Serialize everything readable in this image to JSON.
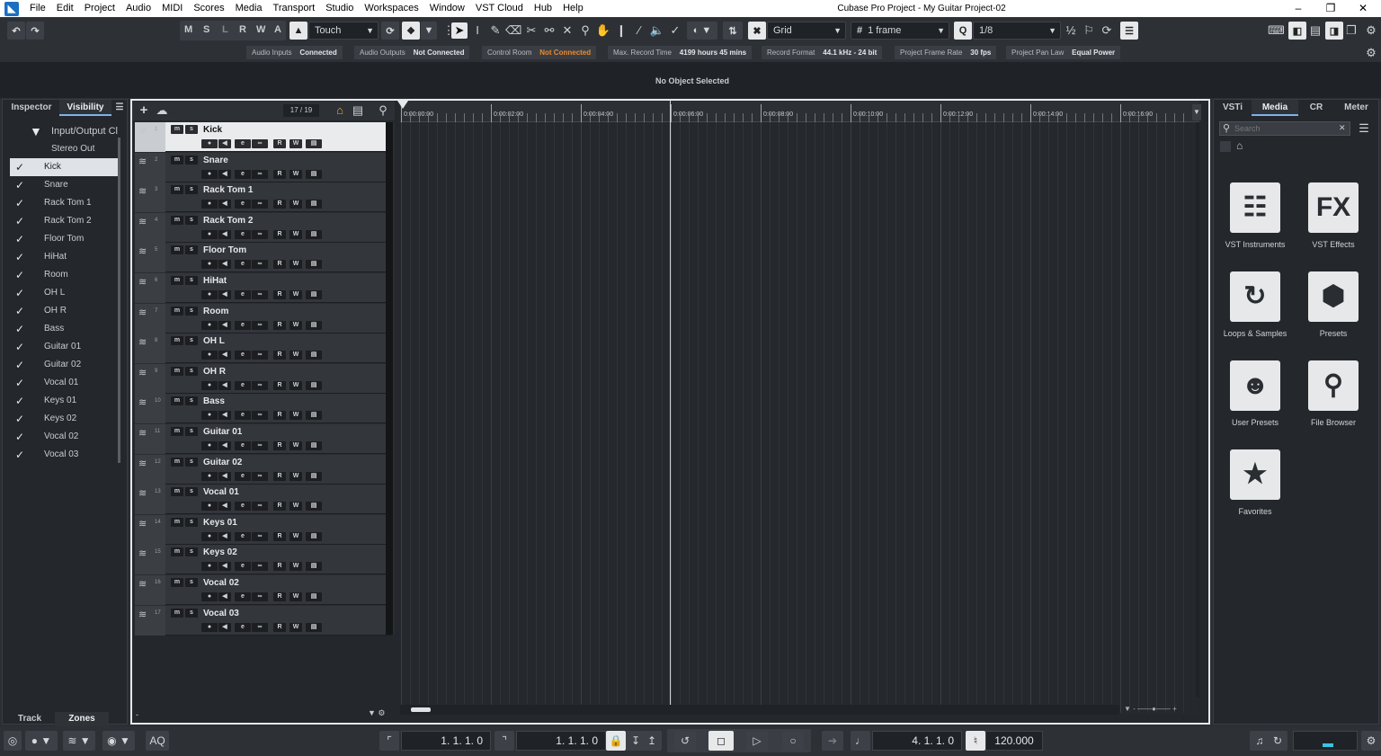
{
  "menubar": {
    "items": [
      "File",
      "Edit",
      "Project",
      "Audio",
      "MIDI",
      "Scores",
      "Media",
      "Transport",
      "Studio",
      "Workspaces",
      "Window",
      "VST Cloud",
      "Hub",
      "Help"
    ],
    "window_title": "Cubase Pro Project - My Guitar Project-02"
  },
  "toolbar": {
    "state_buttons": [
      "M",
      "S",
      "L",
      "R",
      "W",
      "A"
    ],
    "automation_mode": "Touch",
    "snap_type": "Grid",
    "grid_value": "1 frame",
    "quantize_value": "1/8"
  },
  "status": {
    "audio_inputs_label": "Audio Inputs",
    "audio_inputs_value": "Connected",
    "audio_outputs_label": "Audio Outputs",
    "audio_outputs_value": "Not Connected",
    "control_room_label": "Control Room",
    "control_room_value": "Not Connected",
    "record_time_label": "Max. Record Time",
    "record_time_value": "4199 hours 45 mins",
    "record_format_label": "Record Format",
    "record_format_value": "44.1 kHz - 24 bit",
    "frame_rate_label": "Project Frame Rate",
    "frame_rate_value": "30 fps",
    "pan_law_label": "Project Pan Law",
    "pan_law_value": "Equal Power"
  },
  "infoline": {
    "text": "No Object Selected"
  },
  "leftzone": {
    "tabs": [
      "Inspector",
      "Visibility"
    ],
    "root": "Input/Output Cl",
    "stereo_out": "Stereo Out",
    "tracks": [
      "Kick",
      "Snare",
      "Rack Tom 1",
      "Rack Tom 2",
      "Floor Tom",
      "HiHat",
      "Room",
      "OH L",
      "OH R",
      "Bass",
      "Guitar 01",
      "Guitar 02",
      "Vocal 01",
      "Keys 01",
      "Keys 02",
      "Vocal 02",
      "Vocal 03"
    ],
    "bottom_tabs": [
      "Track",
      "Zones"
    ]
  },
  "project": {
    "track_count": "17 / 19",
    "tracks": [
      {
        "num": "1",
        "name": "Kick"
      },
      {
        "num": "2",
        "name": "Snare"
      },
      {
        "num": "3",
        "name": "Rack Tom 1"
      },
      {
        "num": "4",
        "name": "Rack Tom 2"
      },
      {
        "num": "5",
        "name": "Floor Tom"
      },
      {
        "num": "6",
        "name": "HiHat"
      },
      {
        "num": "7",
        "name": "Room"
      },
      {
        "num": "8",
        "name": "OH L"
      },
      {
        "num": "9",
        "name": "OH R"
      },
      {
        "num": "10",
        "name": "Bass"
      },
      {
        "num": "11",
        "name": "Guitar 01"
      },
      {
        "num": "12",
        "name": "Guitar 02"
      },
      {
        "num": "13",
        "name": "Vocal 01"
      },
      {
        "num": "14",
        "name": "Keys 01"
      },
      {
        "num": "15",
        "name": "Keys 02"
      },
      {
        "num": "16",
        "name": "Vocal 02"
      },
      {
        "num": "17",
        "name": "Vocal 03"
      }
    ],
    "ruler_labels": [
      "0:00:00:00",
      "0:00:02:00",
      "0:00:04:00",
      "0:00:06:00",
      "0:00:08:00",
      "0:00:10:00",
      "0:00:12:00",
      "0:00:14:00",
      "0:00:16:00"
    ],
    "track_buttons": {
      "mute": "m",
      "solo": "s",
      "read": "R",
      "write": "W"
    }
  },
  "rightzone": {
    "tabs": [
      "VSTi",
      "Media",
      "CR",
      "Meter"
    ],
    "search_placeholder": "Search",
    "tiles": [
      {
        "label": "VST Instruments",
        "icon": "piano-icon"
      },
      {
        "label": "VST Effects",
        "icon": "fx-icon"
      },
      {
        "label": "Loops & Samples",
        "icon": "loop-icon"
      },
      {
        "label": "Presets",
        "icon": "presets-icon"
      },
      {
        "label": "User Presets",
        "icon": "user-presets-icon"
      },
      {
        "label": "File Browser",
        "icon": "file-browser-icon"
      },
      {
        "label": "Favorites",
        "icon": "star-icon"
      }
    ],
    "fx_text": "FX"
  },
  "transport": {
    "left_locator": "1. 1. 1.   0",
    "right_locator": "1. 1. 1.   0",
    "position": "4. 1. 1.   0",
    "tempo": "120.000",
    "aq_label": "AQ"
  }
}
